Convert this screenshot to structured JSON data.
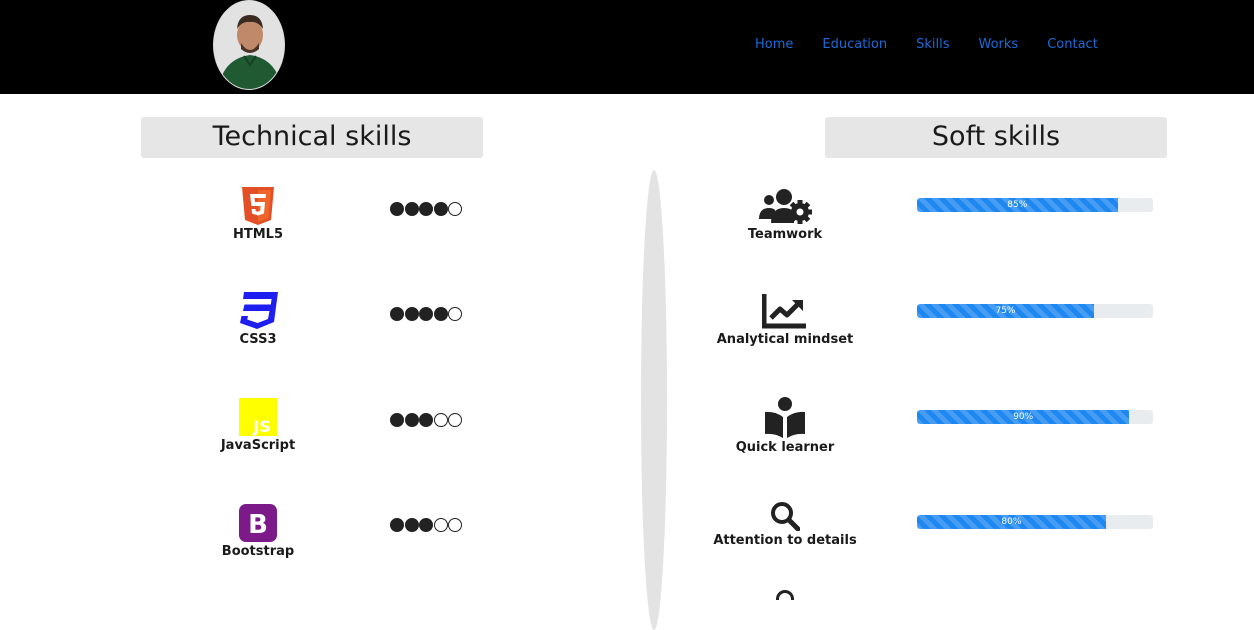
{
  "nav": {
    "items": [
      {
        "label": "Home"
      },
      {
        "label": "Education"
      },
      {
        "label": "Skills"
      },
      {
        "label": "Works"
      },
      {
        "label": "Contact"
      }
    ],
    "link_color": "#1a6bd8"
  },
  "technical": {
    "title": "Technical skills",
    "skills": [
      {
        "label": "HTML5",
        "icon": "html5-icon",
        "rating": 4,
        "max": 5
      },
      {
        "label": "CSS3",
        "icon": "css3-icon",
        "rating": 4,
        "max": 5
      },
      {
        "label": "JavaScript",
        "icon": "javascript-icon",
        "rating": 3,
        "max": 5
      },
      {
        "label": "Bootstrap",
        "icon": "bootstrap-icon",
        "rating": 3,
        "max": 5
      }
    ]
  },
  "soft": {
    "title": "Soft skills",
    "skills": [
      {
        "label": "Teamwork",
        "icon": "users-gear-icon",
        "percent": 85,
        "percent_label": "85%"
      },
      {
        "label": "Analytical mindset",
        "icon": "chart-line-icon",
        "percent": 75,
        "percent_label": "75%"
      },
      {
        "label": "Quick learner",
        "icon": "book-reader-icon",
        "percent": 90,
        "percent_label": "90%"
      },
      {
        "label": "Attention to details",
        "icon": "search-icon",
        "percent": 80,
        "percent_label": "80%"
      }
    ]
  },
  "colors": {
    "header_bg": "#000000",
    "progress_fill": "#1e88f0",
    "html5": "#e34f26",
    "css3": "#1e1ef0",
    "javascript": "#ffff00",
    "bootstrap": "#7b1a88"
  }
}
